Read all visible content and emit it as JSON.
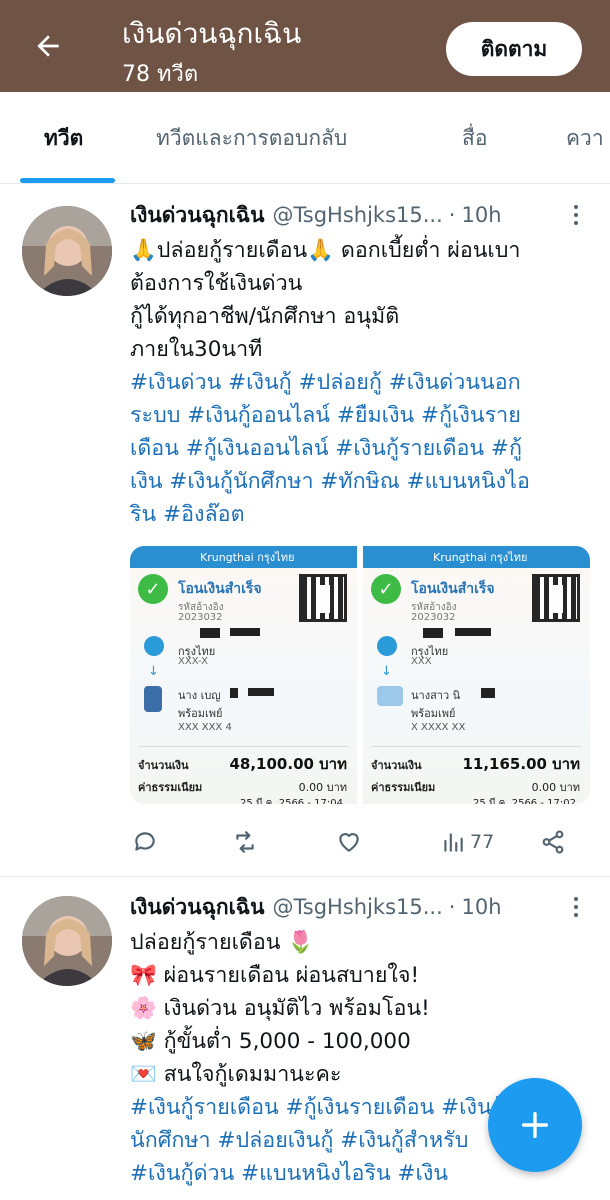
{
  "header": {
    "title": "เงินด่วนฉุกเฉิน",
    "subtitle": "78 ทวีต",
    "follow_label": "ติดตาม",
    "back_icon": "arrow-left-icon"
  },
  "tabs": [
    {
      "label": "ทวีต",
      "active": true
    },
    {
      "label": "ทวีตและการตอบกลับ",
      "active": false
    },
    {
      "label": "สื่อ",
      "active": false
    },
    {
      "label": "ควา",
      "active": false
    }
  ],
  "tweets": [
    {
      "name": "เงินด่วนฉุกเฉิน",
      "handle": "@TsgHshjks15...",
      "time": "10h",
      "lines": [
        "🙏ปล่อยกู้รายเดือน🙏 ดอกเบี้ยต่ำ ผ่อนเบา",
        "ต้องการใช้เงินด่วน",
        "กู้ได้ทุกอาชีพ/นักศึกษา อนุมัติ",
        "ภายใน30นาที"
      ],
      "hashtag_lines": [
        "#เงินด่วน #เงินกู้ #ปล่อยกู้ #เงินด่วนนอก",
        "ระบบ #เงินกู้ออนไลน์ #ยืมเงิน #กู้เงินราย",
        "เดือน #กู้เงินออนไลน์ #เงินกู้รายเดือน #กู้",
        "เงิน #เงินกู้นักศึกษา #ทักษิณ #แบนหนิงไอ",
        "ริน #อิงล๊อต"
      ],
      "images": [
        {
          "bank_logo": "Krungthai กรุงไทย",
          "status": "โอนเงินสำเร็จ",
          "ref_label": "รหัสอ้างอิง",
          "ref_no": "2023032",
          "from_bank": "กรุงไทย",
          "from_acct": "XXX-X",
          "to_name": "นาง เบญ",
          "to_service": "พร้อมเพย์",
          "to_acct": "XXX XXX 4",
          "amount_label": "จำนวนเงิน",
          "amount": "48,100.00 บาท",
          "fee_label": "ค่าธรรมเนียม",
          "fee": "0.00 บาท",
          "date": "25 มี.ค. 2566 - 17:04"
        },
        {
          "bank_logo": "Krungthai กรุงไทย",
          "status": "โอนเงินสำเร็จ",
          "ref_label": "รหัสอ้างอิง",
          "ref_no": "2023032",
          "from_bank": "กรุงไทย",
          "from_acct": "XXX",
          "to_name": "นางสาว นิ",
          "to_service": "พร้อมเพย์",
          "to_acct": "X XXXX XX",
          "amount_label": "จำนวนเงิน",
          "amount": "11,165.00 บาท",
          "fee_label": "ค่าธรรมเนียม",
          "fee": "0.00 บาท",
          "date": "25 มี.ค. 2566 - 17:02"
        }
      ],
      "views": "77"
    },
    {
      "name": "เงินด่วนฉุกเฉิน",
      "handle": "@TsgHshjks15...",
      "time": "10h",
      "lines": [
        "ปล่อยกู้รายเดือน 🌷",
        "🎀 ผ่อนรายเดือน ผ่อนสบายใจ!",
        "🌸 เงินด่วน อนุมัติไว พร้อมโอน!",
        "🦋 กู้ขั้นต่ำ 5,000 - 100,000",
        "💌 สนใจกู้เดมมานะคะ"
      ],
      "hashtag_lines": [
        "#เงินกู้รายเดือน #กู้เงินรายเดือน #เงินกู้",
        "นักศึกษา #ปล่อยเงินกู้ #เงินกู้สำหรับ",
        "#เงินกู้ด่วน #แบนหนิงไอริน #เงิน"
      ]
    }
  ],
  "colors": {
    "header_bg": "#6f5446",
    "accent": "#1d9bf0",
    "hashtag": "#1d70b8"
  }
}
